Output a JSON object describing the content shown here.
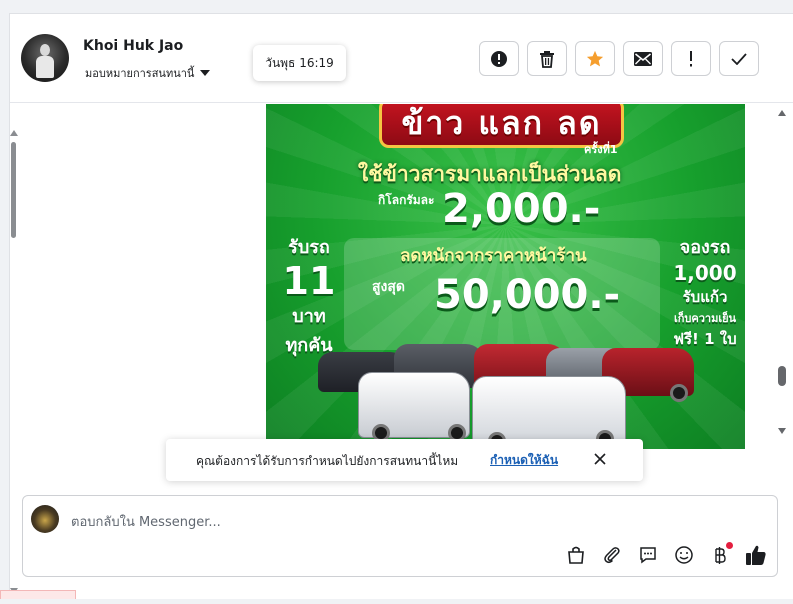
{
  "header": {
    "contact_name": "Khoi Huk Jao",
    "assign_label": "มอบหมายการสนทนานี้",
    "timestamp_tooltip": "วันพุธ 16:19",
    "actions": [
      {
        "name": "report-button",
        "icon": "alert-circle-icon"
      },
      {
        "name": "delete-button",
        "icon": "trash-icon"
      },
      {
        "name": "star-button",
        "icon": "star-icon"
      },
      {
        "name": "mark-unread-button",
        "icon": "envelope-icon"
      },
      {
        "name": "important-button",
        "icon": "exclamation-icon"
      },
      {
        "name": "done-button",
        "icon": "check-icon"
      }
    ]
  },
  "promo_image": {
    "banner": "ข้าว แลก ลด",
    "round": "ครั้งที่1",
    "headline": "ใช้ข้าวสารมาแลกเป็นส่วนลด",
    "per_kg": "กิโลกรัมละ",
    "amount_per_kg": "2,000.-",
    "left_line1": "รับรถ",
    "left_line2": "11",
    "left_line3": "บาท",
    "left_line4": "ทุกคัน",
    "right_line1": "จองรถ",
    "right_line2": "1,000",
    "right_line3": "รับแก้ว",
    "right_line4": "เก็บความเย็น",
    "right_line5": "ฟรี! 1 ใบ",
    "sub": "ลดหนักจากราคาหน้าร้าน",
    "max_label": "สูงสุด",
    "max_amount": "50,000.-"
  },
  "notice": {
    "message": "คุณต้องการได้รับการกำหนดไปยังการสนทนานี้ไหม",
    "link": "กำหนดให้ฉัน"
  },
  "composer": {
    "placeholder": "ตอบกลับใน Messenger...",
    "tools": [
      "saved-replies-icon",
      "paperclip-icon",
      "message-template-icon",
      "emoji-icon",
      "baht-payment-icon",
      "thumbs-up-icon"
    ]
  },
  "colors": {
    "accent": "#1a5fb4",
    "star": "#f59e2e",
    "like": "#1c1e21",
    "badge": "#e41e3f"
  }
}
